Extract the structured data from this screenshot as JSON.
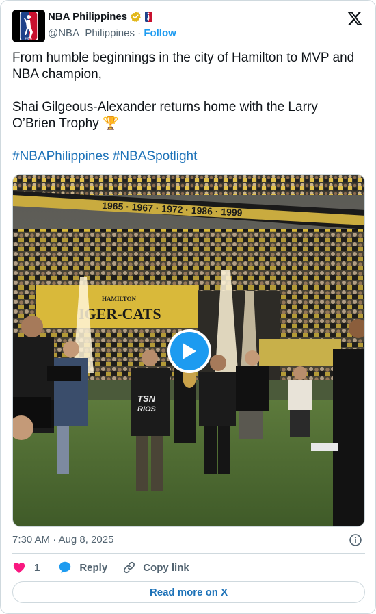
{
  "author": {
    "display_name": "NBA Philippines",
    "handle": "@NBA_Philippines",
    "separator": "·",
    "follow_label": "Follow",
    "verified_color": "#e2b719"
  },
  "tweet": {
    "line1": "From humble beginnings in the city of Hamilton to MVP and NBA champion,",
    "line2": "Shai Gilgeous-Alexander returns home with the Larry O’Brien Trophy 🏆",
    "hashtags": [
      "#NBAPhilippines",
      "#NBASpotlight"
    ]
  },
  "media": {
    "type": "video",
    "stadium_banner_years": "1965 · 1967 · 1972 · 1986 · 1999",
    "tunnel_sign_small": "HAMILTON",
    "tunnel_sign_big": "IGER-CATS",
    "shirt_text_line1": "TSN",
    "shirt_text_line2": "RIOS",
    "play_button_color": "#1d9bf0"
  },
  "meta": {
    "timestamp": "7:30 AM · Aug 8, 2025"
  },
  "actions": {
    "like_count": "1",
    "reply_label": "Reply",
    "copy_label": "Copy link",
    "like_color": "#f91880",
    "reply_color": "#1d9bf0"
  },
  "footer": {
    "read_more_label": "Read more on X"
  }
}
